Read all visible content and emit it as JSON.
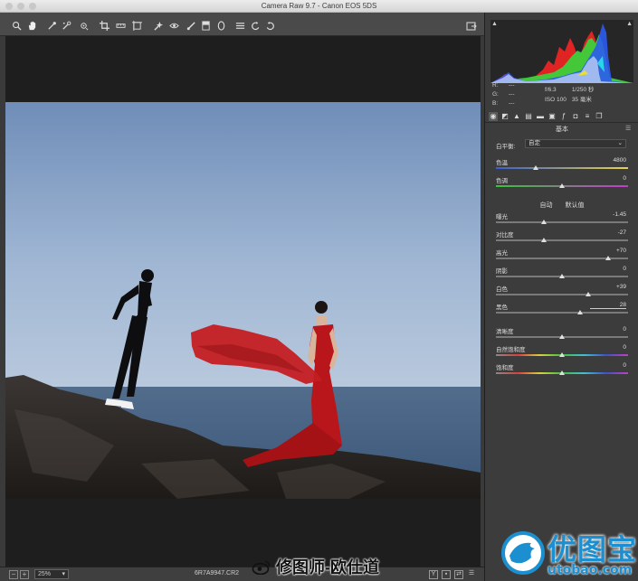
{
  "window": {
    "title": "Camera Raw 9.7  -  Canon EOS 5DS"
  },
  "toolbar": {
    "tools": [
      {
        "name": "zoom-tool-icon"
      },
      {
        "name": "hand-tool-icon"
      },
      {
        "name": "white-balance-tool-icon"
      },
      {
        "name": "color-sampler-tool-icon"
      },
      {
        "name": "targeted-adjustment-tool-icon"
      },
      {
        "name": "crop-tool-icon"
      },
      {
        "name": "straighten-tool-icon"
      },
      {
        "name": "transform-tool-icon"
      },
      {
        "name": "spot-removal-tool-icon"
      },
      {
        "name": "red-eye-tool-icon"
      },
      {
        "name": "adjustment-brush-icon"
      },
      {
        "name": "graduated-filter-icon"
      },
      {
        "name": "radial-filter-icon"
      },
      {
        "name": "preferences-icon"
      },
      {
        "name": "rotate-ccw-icon"
      },
      {
        "name": "rotate-cw-icon"
      }
    ]
  },
  "meta": {
    "r_label": "R:",
    "g_label": "G:",
    "b_label": "B:",
    "r": "---",
    "g": "---",
    "b": "---",
    "aperture": "f/6.3",
    "shutter": "1/250 秒",
    "iso": "ISO 100",
    "focal": "35 毫米"
  },
  "panel": {
    "section_title": "基本",
    "wb_label": "白平衡:",
    "wb_value": "自定",
    "auto": "自动",
    "default": "默认值",
    "sliders_wb": [
      {
        "label": "色温",
        "value": "4800",
        "pos": 0.3
      },
      {
        "label": "色调",
        "value": "0",
        "pos": 0.5
      }
    ],
    "sliders_tone": [
      {
        "label": "曝光",
        "value": "-1.45",
        "pos": 0.36
      },
      {
        "label": "对比度",
        "value": "-27",
        "pos": 0.36
      },
      {
        "label": "高光",
        "value": "+70",
        "pos": 0.85
      },
      {
        "label": "阴影",
        "value": "0",
        "pos": 0.5
      },
      {
        "label": "白色",
        "value": "+39",
        "pos": 0.7
      },
      {
        "label": "黑色",
        "value": "28",
        "pos": 0.64
      }
    ],
    "sliders_presence": [
      {
        "label": "清晰度",
        "value": "0",
        "pos": 0.5
      },
      {
        "label": "自然饱和度",
        "value": "0",
        "pos": 0.5
      },
      {
        "label": "饱和度",
        "value": "0",
        "pos": 0.5
      }
    ]
  },
  "bottombar": {
    "zoom": "25%",
    "filename": "6R7A9947.CR2"
  },
  "watermark": "修图师-欧仕道",
  "logo": {
    "main": "优图宝",
    "sub": "utobao.com"
  },
  "colors": {
    "panel_bg": "#3c3c3c",
    "accent_logo": "#1b8fd0",
    "dress": "#c0171c"
  }
}
